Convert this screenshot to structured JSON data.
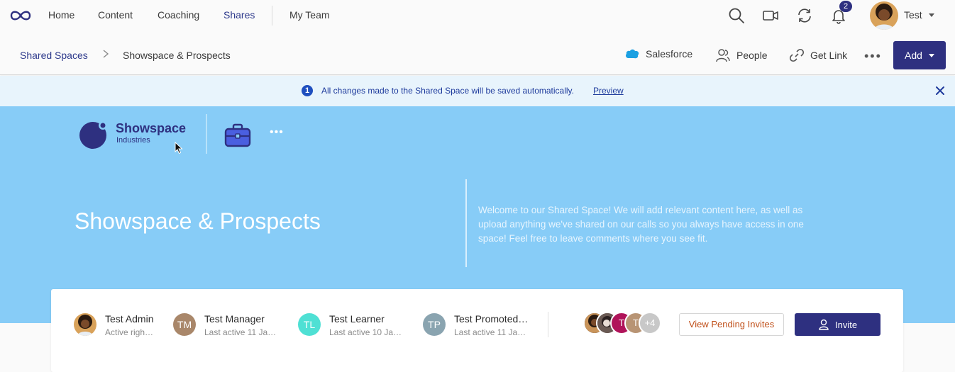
{
  "nav": {
    "items": [
      "Home",
      "Content",
      "Coaching",
      "Shares",
      "My Team"
    ],
    "active": "Shares",
    "notification_count": "2",
    "user_name": "Test"
  },
  "subbar": {
    "breadcrumb_root": "Shared Spaces",
    "breadcrumb_current": "Showspace & Prospects",
    "actions": [
      "Salesforce",
      "People",
      "Get Link"
    ],
    "add_label": "Add"
  },
  "banner": {
    "icon_text": "1",
    "message": "All changes made to the Shared Space will be saved automatically.",
    "link": "Preview"
  },
  "hero": {
    "brand_name": "Showspace",
    "brand_sub": "Industries",
    "title": "Showspace & Prospects",
    "description": "Welcome to our Shared Space! We will add relevant content here, as well as upload anything we've shared on our calls so you always have access in one space! Feel free to leave comments where you see fit.",
    "more": "•••"
  },
  "team": {
    "members": [
      {
        "name": "Test Admin",
        "status": "Active righ…",
        "initials": ""
      },
      {
        "name": "Test Manager",
        "status": "Last active 11 Ja…",
        "initials": "TM"
      },
      {
        "name": "Test Learner",
        "status": "Last active 10 Ja…",
        "initials": "TL"
      },
      {
        "name": "Test Promoted…",
        "status": "Last active 11 Ja…",
        "initials": "TP"
      }
    ],
    "stack_letters": [
      "T",
      "T"
    ],
    "stack_more": "+4",
    "pending_label": "View Pending Invites",
    "invite_label": "Invite"
  },
  "colors": {
    "brand": "#2e3080",
    "hero_bg": "#87ccf7",
    "banner_bg": "#e8f4fc",
    "tm": "#a9876a",
    "tl": "#4fe0d4",
    "tp": "#8aa4b0"
  }
}
